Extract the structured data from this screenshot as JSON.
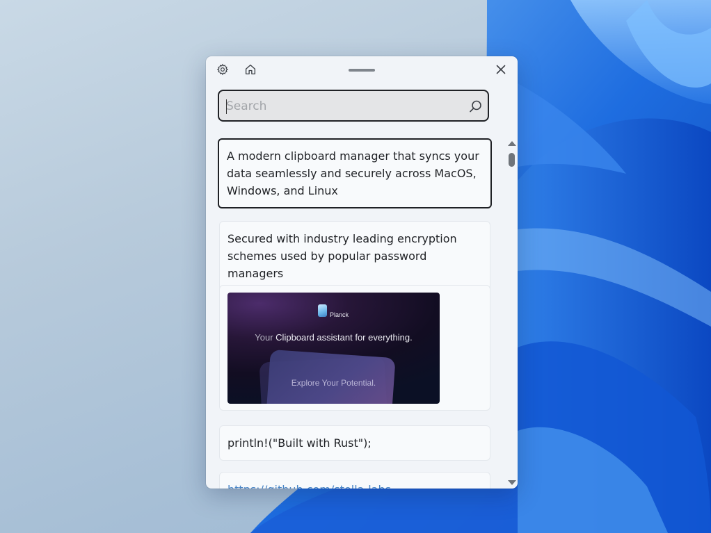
{
  "window": {
    "settings_icon": "gear-icon",
    "home_icon": "home-icon",
    "close_icon": "close-icon"
  },
  "search": {
    "placeholder": "Search",
    "icon": "search-icon"
  },
  "clips": [
    {
      "type": "text",
      "text": "A modern clipboard manager that syncs your data seamlessly and securely across MacOS, Windows, and Linux",
      "selected": true
    },
    {
      "type": "text",
      "text": "Secured with industry leading encryption schemes used by popular password managers"
    },
    {
      "type": "image",
      "brand": "Planck",
      "tagline_prefix": "Your",
      "tagline_bold": "Clipboard assistant for everything.",
      "cta": "Explore Your Potential."
    },
    {
      "type": "text",
      "text": "println!(\"Built with Rust\");"
    },
    {
      "type": "link",
      "text": "https://github.com/stella-labs"
    }
  ],
  "colors": {
    "accent_border": "#1f2125",
    "link": "#4a86c7",
    "panel_bg": "#f1f4f8"
  }
}
